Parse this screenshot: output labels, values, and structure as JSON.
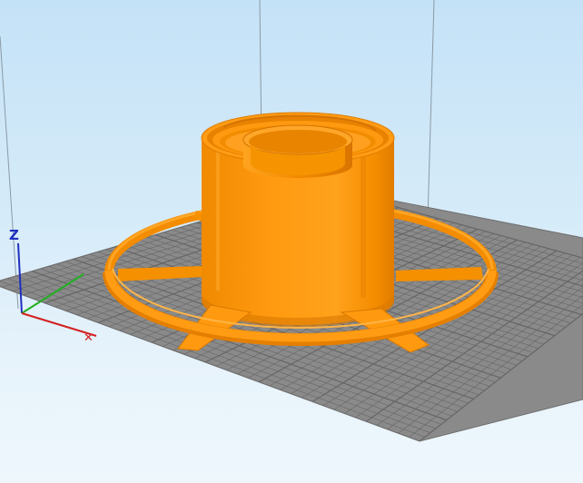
{
  "viewport": {
    "background_top": "#c4e2f7",
    "background_bottom": "#eef7fc"
  },
  "bed": {
    "color": "#8a8a8a",
    "grid_color": "#5e5e5e"
  },
  "model": {
    "color": "#ff9900",
    "shadow_color": "#d97800",
    "highlight_color": "#ffb43a",
    "spokes": 6
  },
  "axes": {
    "z_label": "Z",
    "x_color": "#d32020",
    "y_color": "#20b020",
    "z_color": "#2030c0"
  }
}
